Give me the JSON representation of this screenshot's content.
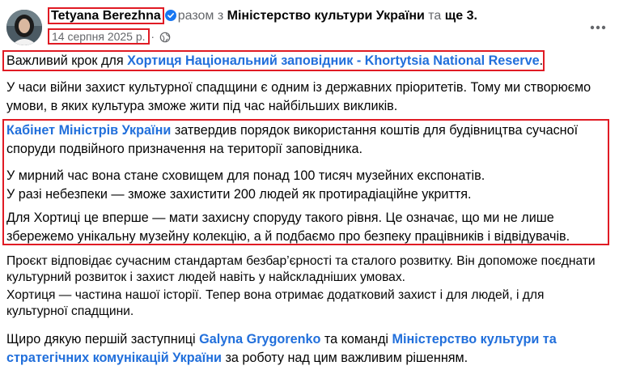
{
  "post": {
    "author": "Tetyana Berezhna",
    "with_prefix": "разом з",
    "with_page": "Міністерство культури України",
    "and": "та",
    "others": "ще 3",
    "date": "14 серпня 2025 р.",
    "dot": "·"
  },
  "body": {
    "p1_prefix": "Важливий крок для",
    "p1_link": "Хортиця Національний заповідник - Khortytsia National Reserve",
    "p1_suffix": ".",
    "p2": "У часи війни захист культурної спадщини є одним із державних пріоритетів. Тому ми створюємо умови, в яких культура зможе жити під час найбільших викликів.",
    "p3_link": "Кабінет Міністрів України",
    "p3_text": "затвердив порядок використання коштів для будівництва сучасної споруди подвійного призначення на території заповідника.",
    "p4_line1": "У мирний час вона стане сховищем для понад 100 тисяч музейних експонатів.",
    "p4_line2": "У разі небезпеки — зможе захистити 200 людей як протирадіаційне укриття.",
    "p5": "Для Хортиці це вперше — мати захисну споруду такого рівня. Це означає, що ми не лише збережемо унікальну музейну колекцію, а й подбаємо про безпеку працівників і відвідувачів.",
    "p6": "Проєкт відповідає сучасним стандартам безбар’єрності та сталого розвитку. Він допоможе поєднати культурний розвиток і захист людей навіть у найскладніших умовах.",
    "p7": "Хортиця — частина нашої історії. Тепер вона отримає додатковий захист і для людей, і для культурної спадщини.",
    "p8_prefix": "Щиро дякую першій заступниці",
    "p8_link1": "Galyna Grygorenko",
    "p8_mid": "та команді",
    "p8_link2": "Міністерство культури та стратегічних комунікацій України",
    "p8_suffix": "за роботу над цим важливим рішенням."
  },
  "icons": {
    "verified": "verified-badge-icon",
    "globe": "globe-icon",
    "more": "more-options-icon"
  },
  "colors": {
    "link": "#216fdb",
    "highlight": "#e01b24",
    "muted": "#65676b"
  }
}
